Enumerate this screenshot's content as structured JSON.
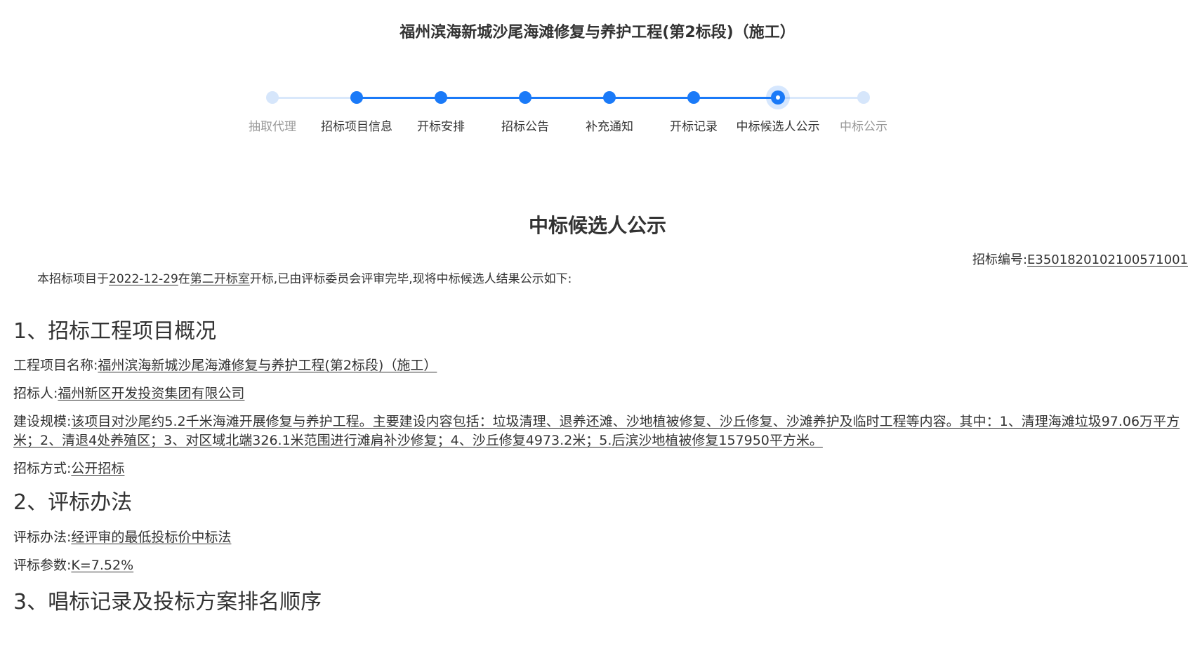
{
  "page": {
    "title": "福州滨海新城沙尾海滩修复与养护工程(第2标段)（施工）"
  },
  "stepper": {
    "steps": [
      {
        "label": "抽取代理",
        "state": "pending"
      },
      {
        "label": "招标项目信息",
        "state": "done"
      },
      {
        "label": "开标安排",
        "state": "done"
      },
      {
        "label": "招标公告",
        "state": "done"
      },
      {
        "label": "补充通知",
        "state": "done"
      },
      {
        "label": "开标记录",
        "state": "done"
      },
      {
        "label": "中标候选人公示",
        "state": "current"
      },
      {
        "label": "中标公示",
        "state": "pending"
      }
    ],
    "colors": {
      "active": "#1a7af8",
      "inactive": "#d9e8fb"
    }
  },
  "notice": {
    "title": "中标候选人公示",
    "bid_no_label": "招标编号:",
    "bid_no_value": "E3501820102100571001",
    "intro": {
      "prefix": "本招标项目于",
      "date": "2022-12-29",
      "mid": "在",
      "room": "第二开标室",
      "suffix": "开标,已由评标委员会评审完毕,现将中标候选人结果公示如下:"
    }
  },
  "section1": {
    "heading": "1、招标工程项目概况",
    "project_name_label": "工程项目名称:",
    "project_name_value": "福州滨海新城沙尾海滩修复与养护工程(第2标段)（施工）",
    "tenderer_label": "招标人:",
    "tenderer_value": "福州新区开发投资集团有限公司",
    "scale_label": "建设规模:",
    "scale_value": "该项目对沙尾约5.2千米海滩开展修复与养护工程。主要建设内容包括：垃圾清理、退养还滩、沙地植被修复、沙丘修复、沙滩养护及临时工程等内容。其中：1、清理海滩垃圾97.06万平方米；2、清退4处养殖区；3、对区域北端326.1米范围进行滩肩补沙修复；4、沙丘修复4973.2米；5.后滨沙地植被修复157950平方米。",
    "method_label": "招标方式:",
    "method_value": "公开招标"
  },
  "section2": {
    "heading": "2、评标办法",
    "method_label": "评标办法:",
    "method_value": "经评审的最低投标价中标法",
    "param_label": "评标参数:",
    "param_value": "K=7.52%"
  },
  "section3": {
    "heading": "3、唱标记录及投标方案排名顺序"
  }
}
